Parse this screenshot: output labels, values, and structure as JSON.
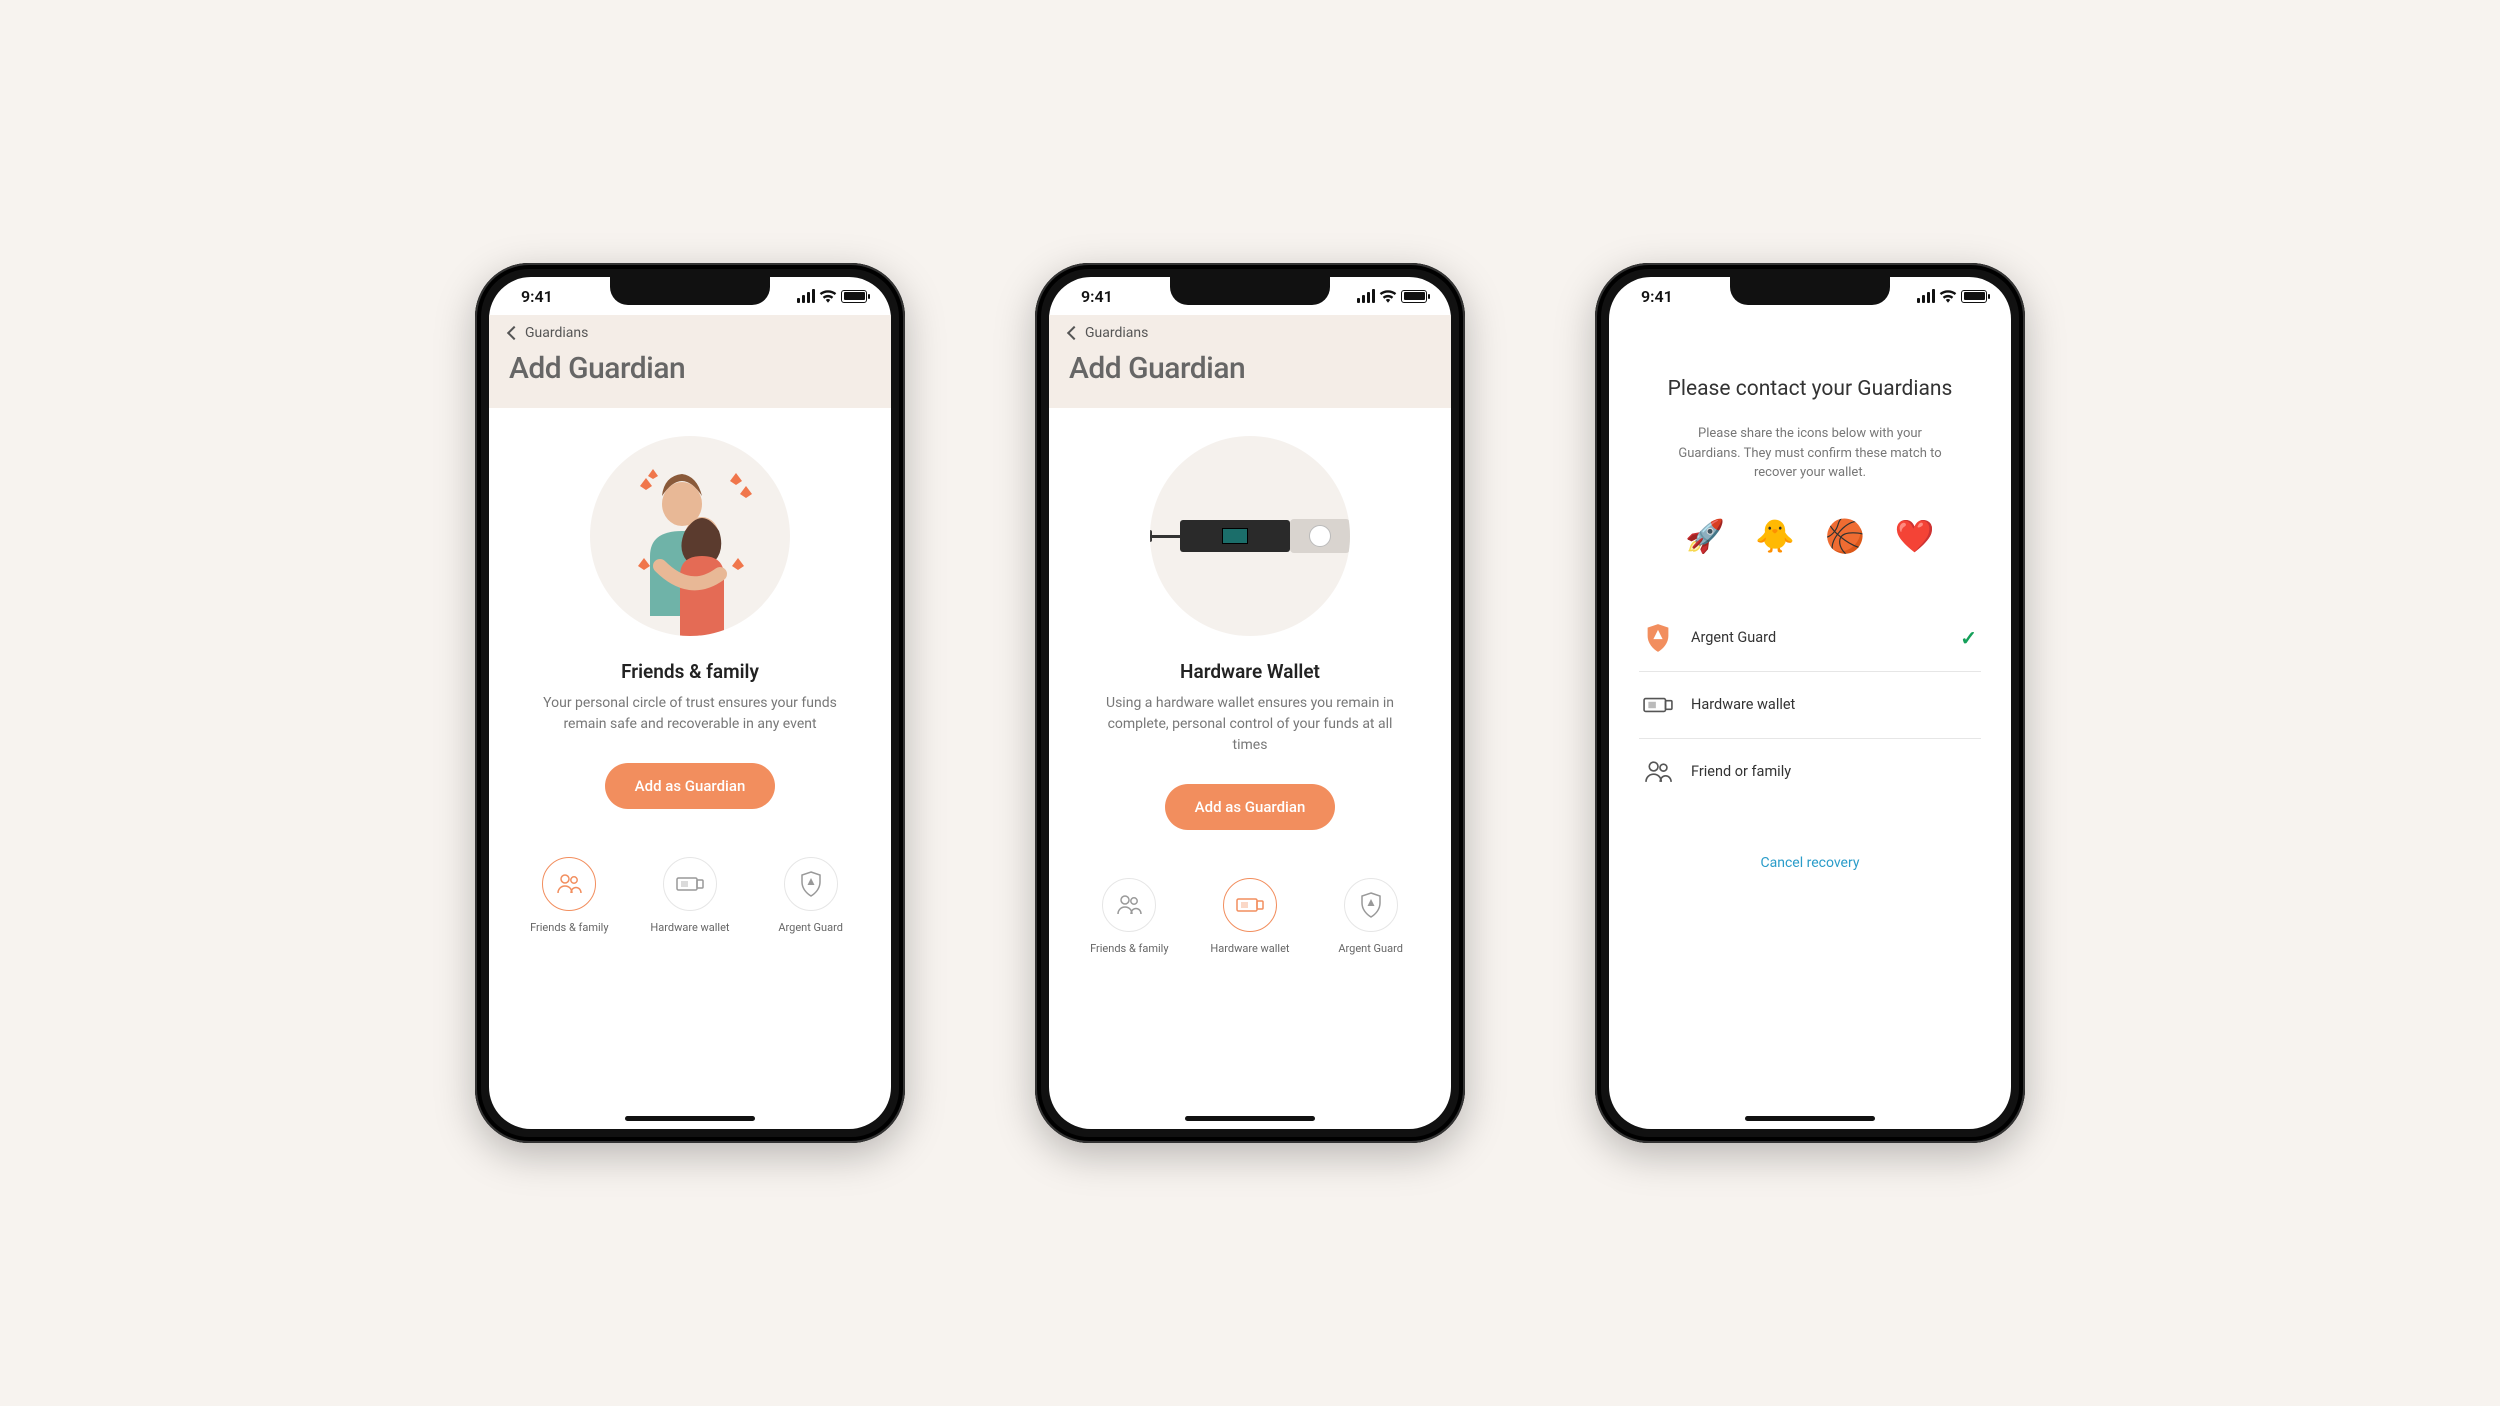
{
  "status": {
    "time": "9:41"
  },
  "screen1": {
    "breadcrumb": "Guardians",
    "title": "Add Guardian",
    "hero_title": "Friends & family",
    "hero_desc": "Your personal circle of trust ensures your funds remain safe and recoverable in any event",
    "cta": "Add as Guardian",
    "tabs": [
      {
        "label": "Friends & family"
      },
      {
        "label": "Hardware wallet"
      },
      {
        "label": "Argent Guard"
      }
    ]
  },
  "screen2": {
    "breadcrumb": "Guardians",
    "title": "Add Guardian",
    "hero_title": "Hardware Wallet",
    "hero_desc": "Using a hardware wallet ensures you remain in complete, personal control of your funds at all times",
    "cta": "Add as Guardian",
    "tabs": [
      {
        "label": "Friends & family"
      },
      {
        "label": "Hardware wallet"
      },
      {
        "label": "Argent Guard"
      }
    ]
  },
  "screen3": {
    "title": "Please contact your Guardians",
    "desc": "Please share the icons below with your Guardians. They must confirm these match to recover your wallet.",
    "emojis": [
      "🚀",
      "🐥",
      "🏀",
      "❤️"
    ],
    "guardians": [
      {
        "label": "Argent Guard",
        "confirmed": true
      },
      {
        "label": "Hardware wallet",
        "confirmed": false
      },
      {
        "label": "Friend or family",
        "confirmed": false
      }
    ],
    "cancel": "Cancel recovery"
  }
}
